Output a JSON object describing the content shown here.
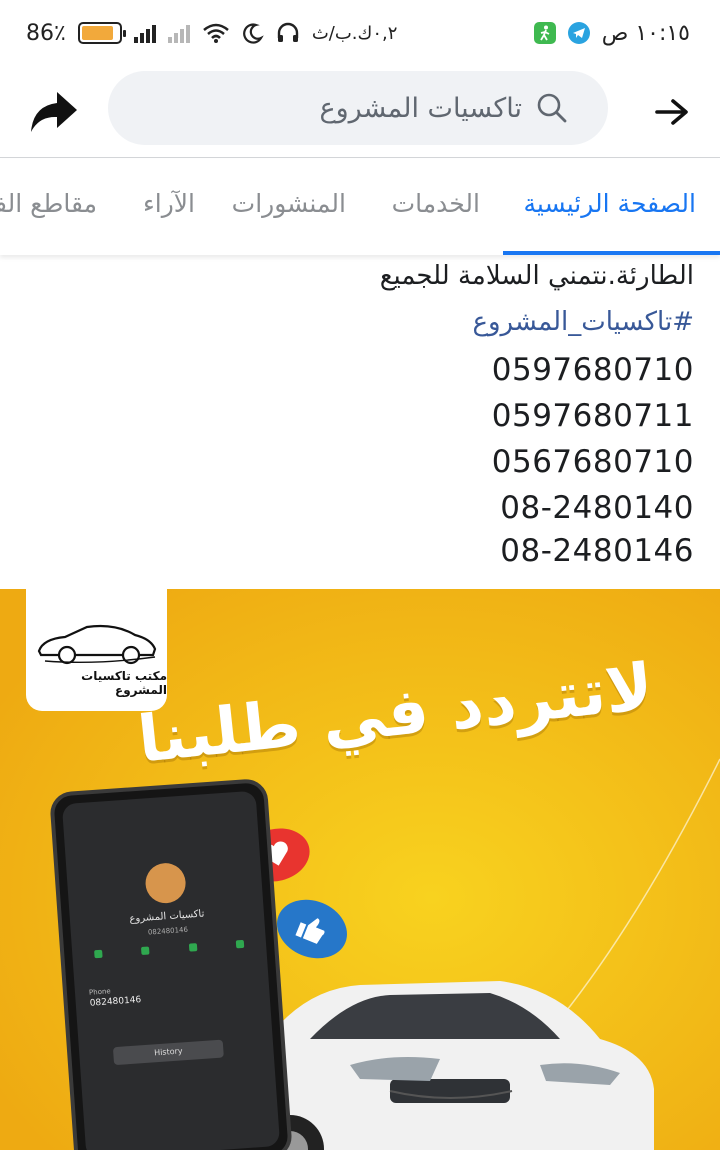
{
  "status_bar": {
    "time": "١٠:١٥ ص",
    "battery_percent_text": "86٪",
    "battery_level": 0.86,
    "data_speed": "٠,٢ك.ب/ث"
  },
  "header": {
    "search_text": "تاكسيات المشروع",
    "back_icon": "arrow-right-icon",
    "share_icon": "share-arrow-icon",
    "search_icon": "search-icon"
  },
  "tabs": [
    {
      "label": "الصفحة الرئيسية",
      "active": true
    },
    {
      "label": "الخدمات",
      "active": false
    },
    {
      "label": "المنشورات",
      "active": false
    },
    {
      "label": "الآراء",
      "active": false
    },
    {
      "label": "مقاطع الفيديو",
      "active": false
    }
  ],
  "post": {
    "text_line": "الطارئة.نتمني السلامة للجميع",
    "hashtag": "#تاكسيات_المشروع",
    "phones": [
      "0597680710",
      "0597680711",
      "0567680710",
      "08-2480140",
      "08-2480146"
    ]
  },
  "image": {
    "background_color": "#f2b419",
    "logo_text": "مكتب تاكسيات المشروع",
    "headline": "لاتتردد في طلبنا",
    "phone_screen": {
      "contact_name": "تاكسيات المشروع",
      "contact_number": "082480146",
      "phone_label": "Phone",
      "phone_number": "082480146",
      "history_label": "History"
    }
  },
  "colors": {
    "accent": "#1876f2",
    "hashtag": "#385898",
    "inactive_tab": "#8a8d91"
  }
}
